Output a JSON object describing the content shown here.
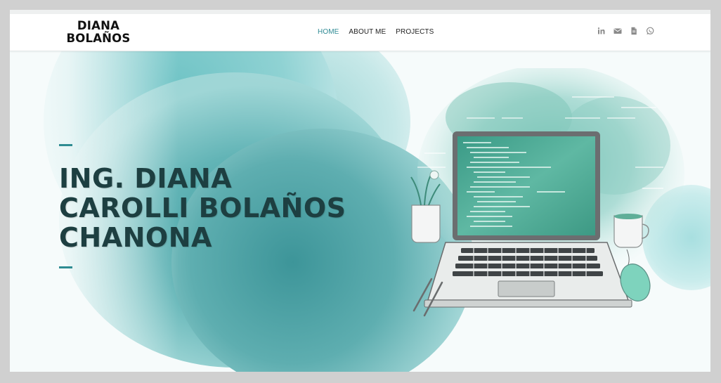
{
  "brand": {
    "line1": "DIANA",
    "line2": "BOLAÑOS"
  },
  "nav": {
    "items": [
      {
        "label": "HOME",
        "active": true
      },
      {
        "label": "ABOUT ME"
      },
      {
        "label": "PROJECTS"
      }
    ]
  },
  "socials": [
    {
      "icon": "linkedin-icon"
    },
    {
      "icon": "envelope-icon"
    },
    {
      "icon": "file-icon"
    },
    {
      "icon": "whatsapp-icon"
    }
  ],
  "hero": {
    "title_line1": "ING. DIANA",
    "title_line2": "CAROLLI BOLAÑOS",
    "title_line3": "CHANONA",
    "illustration": "laptop-code-illustration"
  },
  "colors": {
    "accent": "#2e8a94",
    "title": "#1d3f41",
    "teal": "#4fa8ab"
  }
}
